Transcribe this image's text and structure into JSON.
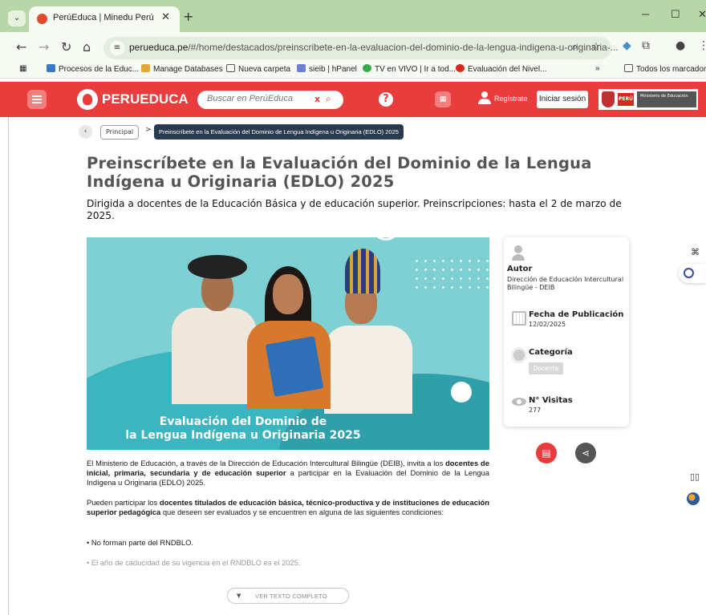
{
  "browser": {
    "tab_title": "PerúEduca | Minedu Perú",
    "tab_close": "✕",
    "new_tab": "+",
    "url_host": "perueduca.pe",
    "url_path": "/#/home/destacados/preinscribete-en-la-evaluacion-del-dominio-de-la-lengua-indigena-u-originaria-...",
    "bookmarks": [
      "Procesos de la Educ...",
      "Manage Databases",
      "Nueva carpeta",
      "sieib | hPanel",
      "TV en VIVO | Ir a tod...",
      "Evaluación del Nivel...",
      "Todos los marcadores"
    ],
    "bookmarks_more": "»"
  },
  "site": {
    "logo_text": "PERUEDUCA",
    "search_placeholder": "Buscar en PerúEduca",
    "search_clear": "x",
    "help": "?",
    "register": "Regístrate",
    "login": "Iniciar sesión",
    "peru_label": "PERÚ",
    "ministry_label": "Ministerio de Educación"
  },
  "breadcrumb": {
    "back": "‹",
    "home": "Principal",
    "sep": ">",
    "current": "Preinscríbete en la Evaluación del Dominio de Lengua Indígena u Originaria (EDLO) 2025"
  },
  "article": {
    "title": "Preinscríbete en la Evaluación del Dominio de la Lengua Indígena u Originaria (EDLO) 2025",
    "subtitle": "Dirigida a docentes de la Educación Básica y de educación superior. Preinscripciones: hasta el 2 de marzo de 2025.",
    "hero_caption_line1": "Evaluación del Dominio de",
    "hero_caption_line2": "la Lengua Indígena u Originaria 2025",
    "p1_a": "El Ministerio de Educación, a través de la Dirección de Educación Intercultural Bilingüe (DEIB), invita a los ",
    "p1_b": "docentes de inicial, primaria, secundaria y de educación superior",
    "p1_c": " a participar en la Evaluación del Dominio de la Lengua Indígena u Originaria (EDLO) 2025.",
    "p2_a": "Pueden participar los ",
    "p2_b": "docentes titulados de educación básica, técnico-productiva y de instituciones de educación superior pedagógica",
    "p2_c": " que deseen ser evaluados y se encuentren en alguna de las siguientes condiciones:",
    "bullet1": "• No forman parte del RNDBLO.",
    "bullet2": "• El año de caducidad de su vigencia en el RNDBLO es el 2025.",
    "read_more": "VER TEXTO COMPLETO"
  },
  "sidebar": {
    "author_label": "Autor",
    "author_value": "Dirección de Educación Intercultural Bilingüe - DEIB",
    "date_label": "Fecha de Publicación",
    "date_value": "12/02/2025",
    "category_label": "Categoría",
    "category_value": "Docente",
    "visits_label": "N° Visitas",
    "visits_value": "277"
  },
  "colors": {
    "brand_red": "#e93c3d",
    "chrome_green": "#b7d7a8",
    "hero_teal": "#3bb6c0"
  }
}
